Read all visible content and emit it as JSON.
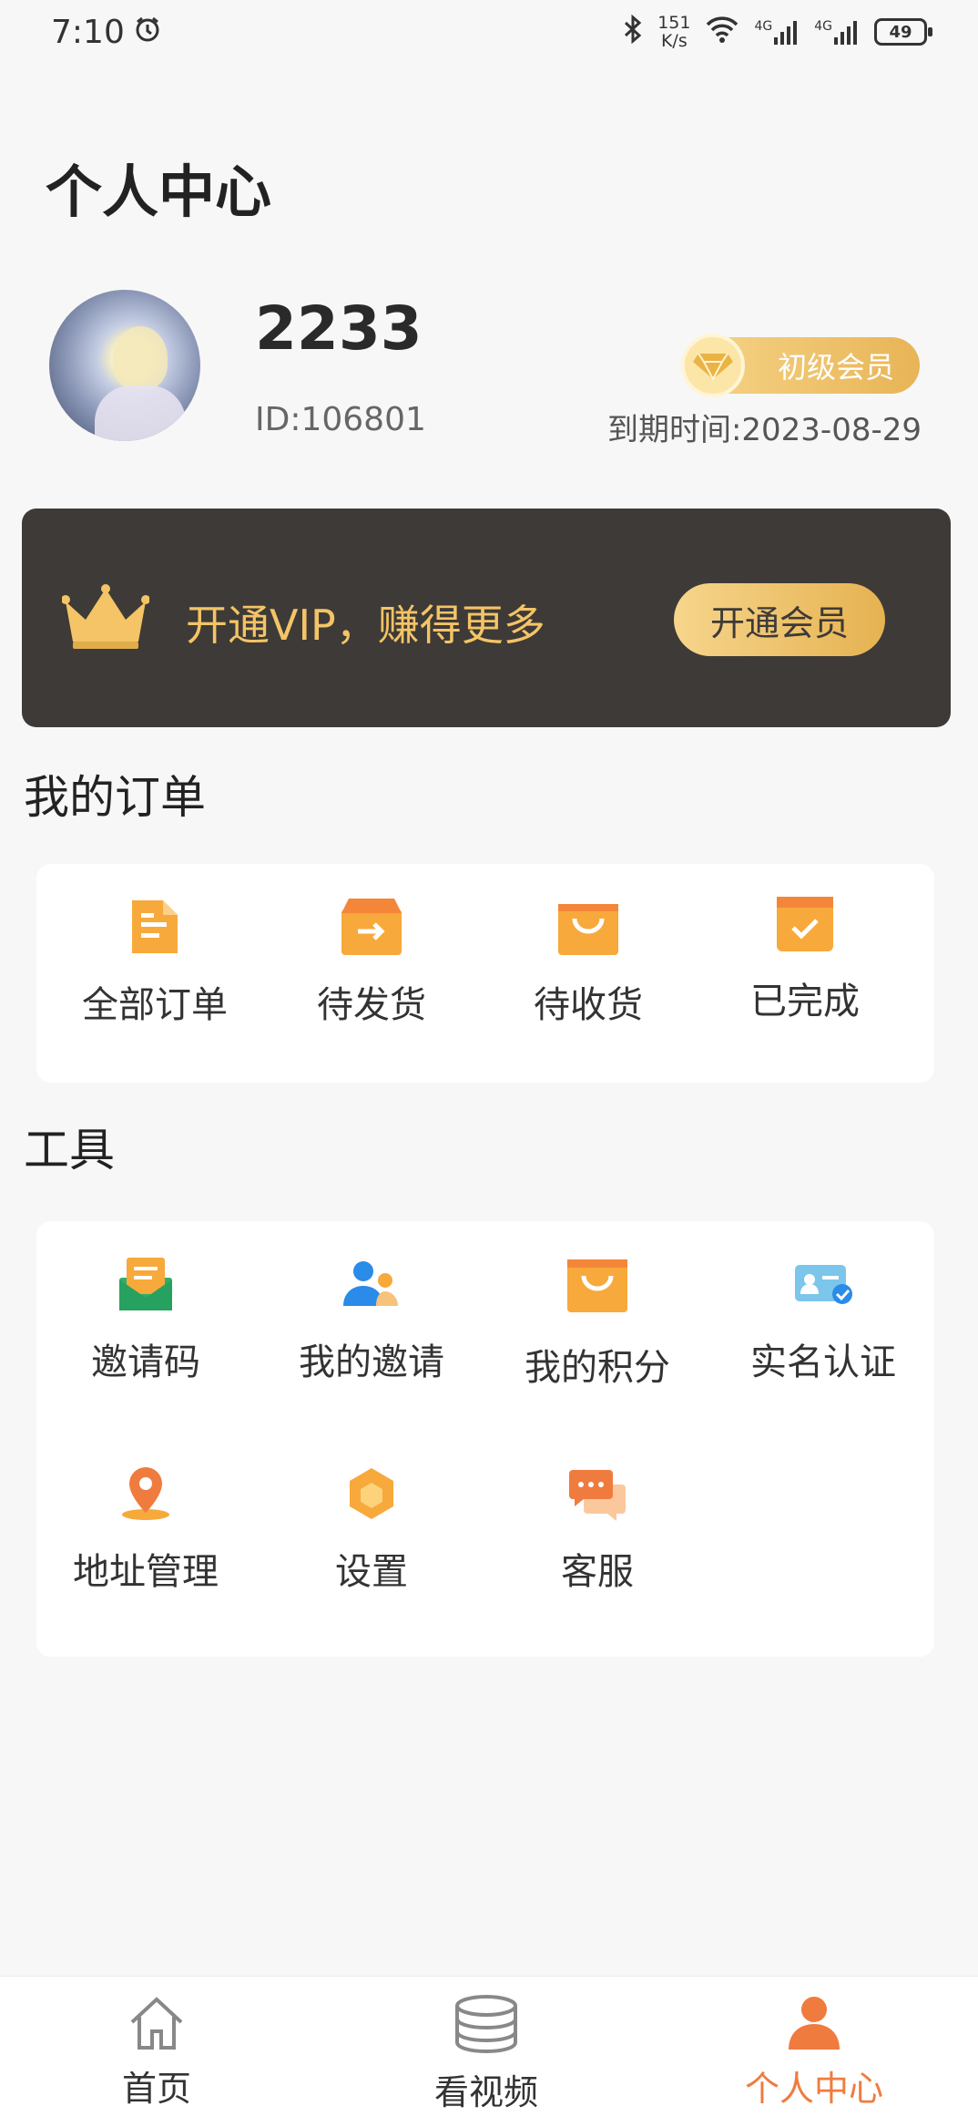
{
  "status_bar": {
    "time": "7:10",
    "speed_value": "151",
    "speed_unit": "K/s",
    "net1": "4G",
    "net2": "4G",
    "battery": "49"
  },
  "page_title": "个人中心",
  "profile": {
    "name": "2233",
    "id_text": "ID:106801",
    "member_level": "初级会员",
    "expire_text": "到期时间:2023-08-29"
  },
  "vip_banner": {
    "text": "开通VIP，赚得更多",
    "button": "开通会员"
  },
  "orders": {
    "title": "我的订单",
    "items": [
      {
        "label": "全部订单",
        "icon": "document-icon"
      },
      {
        "label": "待发货",
        "icon": "box-arrow-icon"
      },
      {
        "label": "待收货",
        "icon": "bag-icon"
      },
      {
        "label": "已完成",
        "icon": "box-check-icon"
      }
    ]
  },
  "tools": {
    "title": "工具",
    "items": [
      {
        "label": "邀请码",
        "icon": "envelope-icon"
      },
      {
        "label": "我的邀请",
        "icon": "users-icon"
      },
      {
        "label": "我的积分",
        "icon": "shopping-bag-icon"
      },
      {
        "label": "实名认证",
        "icon": "id-card-icon"
      },
      {
        "label": "地址管理",
        "icon": "location-pin-icon"
      },
      {
        "label": "设置",
        "icon": "hexagon-settings-icon"
      },
      {
        "label": "客服",
        "icon": "chat-bubbles-icon"
      }
    ]
  },
  "bottom_nav": {
    "items": [
      {
        "label": "首页",
        "icon": "home-icon"
      },
      {
        "label": "看视频",
        "icon": "database-icon"
      },
      {
        "label": "个人中心",
        "icon": "person-icon"
      }
    ],
    "active_index": 2
  },
  "colors": {
    "accent_orange": "#f07b3f",
    "icon_orange": "#f7a93b",
    "vip_dark": "#3e3a37",
    "vip_gold": "#f4c466"
  }
}
